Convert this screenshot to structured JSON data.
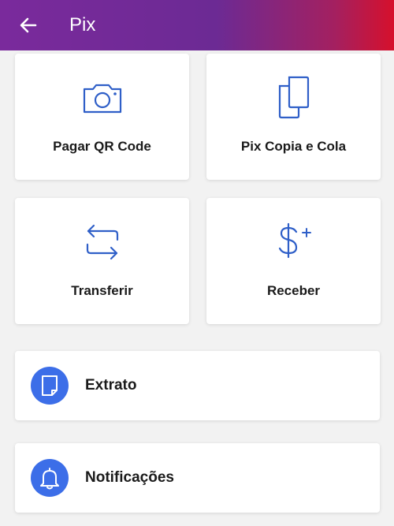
{
  "header": {
    "title": "Pix",
    "back_icon": "arrow-left-icon",
    "gradient": [
      "#7a2a9c",
      "#6c2a94",
      "#a42060",
      "#d6102c"
    ]
  },
  "grid": [
    {
      "label": "Pagar QR Code",
      "icon": "camera-icon"
    },
    {
      "label": "Pix Copia e Cola",
      "icon": "copy-icon"
    },
    {
      "label": "Transferir",
      "icon": "transfer-arrows-icon"
    },
    {
      "label": "Receber",
      "icon": "dollar-plus-icon"
    }
  ],
  "rows": [
    {
      "label": "Extrato",
      "icon": "document-icon"
    },
    {
      "label": "Notificações",
      "icon": "bell-icon"
    }
  ],
  "colors": {
    "icon_stroke": "#2f5fc8",
    "circle_bg": "#3c6ee8",
    "card_bg": "#ffffff",
    "page_bg": "#f2f2f2"
  }
}
